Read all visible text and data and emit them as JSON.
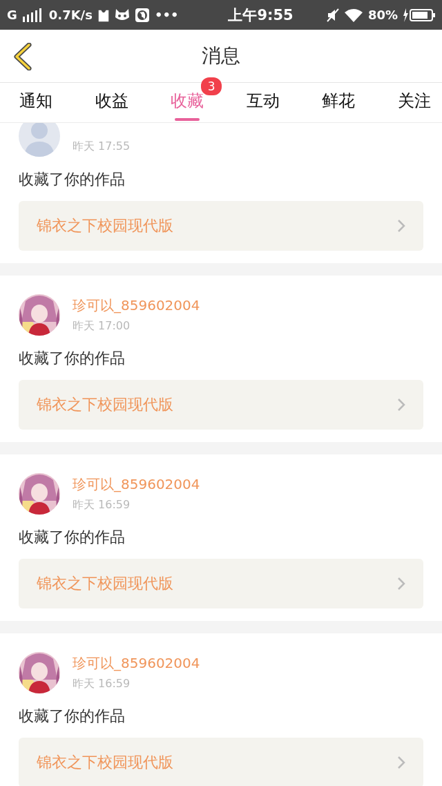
{
  "status_bar": {
    "network": "G",
    "speed": "0.7K/s",
    "more": "•••",
    "time": "上午9:55",
    "battery": "80%"
  },
  "header": {
    "title": "消息"
  },
  "tabs": [
    {
      "label": "通知",
      "selected": false
    },
    {
      "label": "收益",
      "selected": false
    },
    {
      "label": "收藏",
      "selected": true,
      "badge": "3"
    },
    {
      "label": "互动",
      "selected": false
    },
    {
      "label": "鲜花",
      "selected": false
    },
    {
      "label": "关注",
      "selected": false
    }
  ],
  "messages": [
    {
      "avatar": {
        "kind": "default"
      },
      "time": "昨天 17:55",
      "action": "收藏了你的作品",
      "work": "锦衣之下校园现代版"
    },
    {
      "name": "珍可以_859602004",
      "time": "昨天 17:00",
      "action": "收藏了你的作品",
      "work": "锦衣之下校园现代版"
    },
    {
      "name": "珍可以_859602004",
      "time": "昨天 16:59",
      "action": "收藏了你的作品",
      "work": "锦衣之下校园现代版"
    },
    {
      "name": "珍可以_859602004",
      "time": "昨天 16:59",
      "action": "收藏了你的作品",
      "work": "锦衣之下校园现代版"
    }
  ]
}
